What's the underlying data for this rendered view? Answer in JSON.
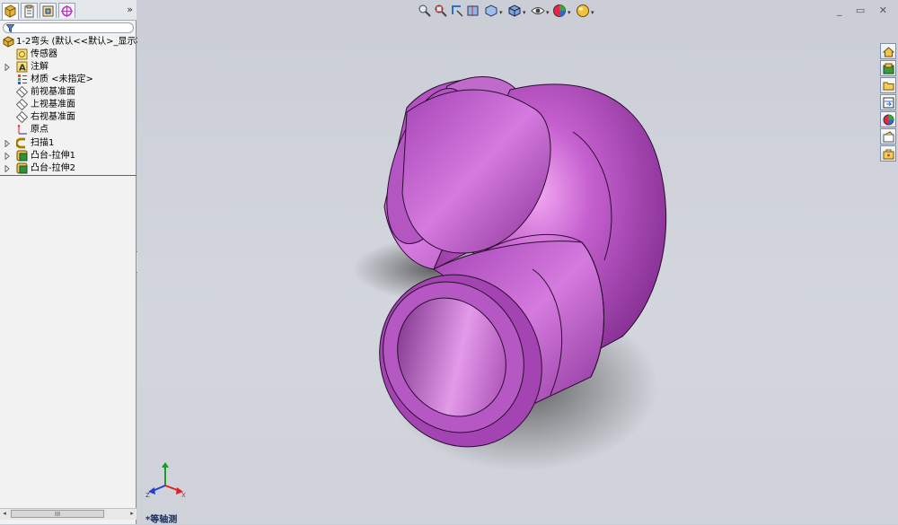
{
  "panel": {
    "tabs": [
      {
        "icon": "featuremanager-tab-icon"
      },
      {
        "icon": "propertymanager-tab-icon"
      },
      {
        "icon": "configurationmanager-tab-icon"
      },
      {
        "icon": "dimxpertmanager-tab-icon"
      }
    ],
    "expand_label": "»",
    "filter_icon": "filter-icon",
    "tree": [
      {
        "label": "1-2弯头  (默认<<默认>_显示状",
        "icon": "part-icon"
      },
      {
        "label": "传感器",
        "icon": "sensor-icon"
      },
      {
        "label": "注解",
        "icon": "annotation-icon"
      },
      {
        "label": "材质 <未指定>",
        "icon": "material-icon"
      },
      {
        "label": "前视基准面",
        "icon": "plane-icon"
      },
      {
        "label": "上视基准面",
        "icon": "plane-icon"
      },
      {
        "label": "右视基准面",
        "icon": "plane-icon"
      },
      {
        "label": "原点",
        "icon": "origin-icon"
      },
      {
        "label": "扫描1",
        "icon": "sweep-icon"
      },
      {
        "label": "凸台-拉伸1",
        "icon": "extrude-icon"
      },
      {
        "label": "凸台-拉伸2",
        "icon": "extrude-icon"
      }
    ],
    "scroll_thumb": "III"
  },
  "viewport": {
    "view_label": "*等轴测",
    "window_controls": "_ ▭ ✕",
    "model_color": "#b04ec0",
    "background_color": "#cbced6"
  },
  "heads_up_toolbar": [
    "zoom-to-fit-icon",
    "zoom-to-area-icon",
    "previous-view-icon",
    "section-view-icon",
    "view-orientation-icon",
    "display-style-icon",
    "hide-show-items-icon",
    "edit-appearance-icon",
    "apply-scene-icon"
  ],
  "task_pane": [
    "solidworks-resources-icon",
    "design-library-icon",
    "file-explorer-icon",
    "view-palette-icon",
    "appearances-icon",
    "custom-properties-icon",
    "toolbox-icon"
  ]
}
